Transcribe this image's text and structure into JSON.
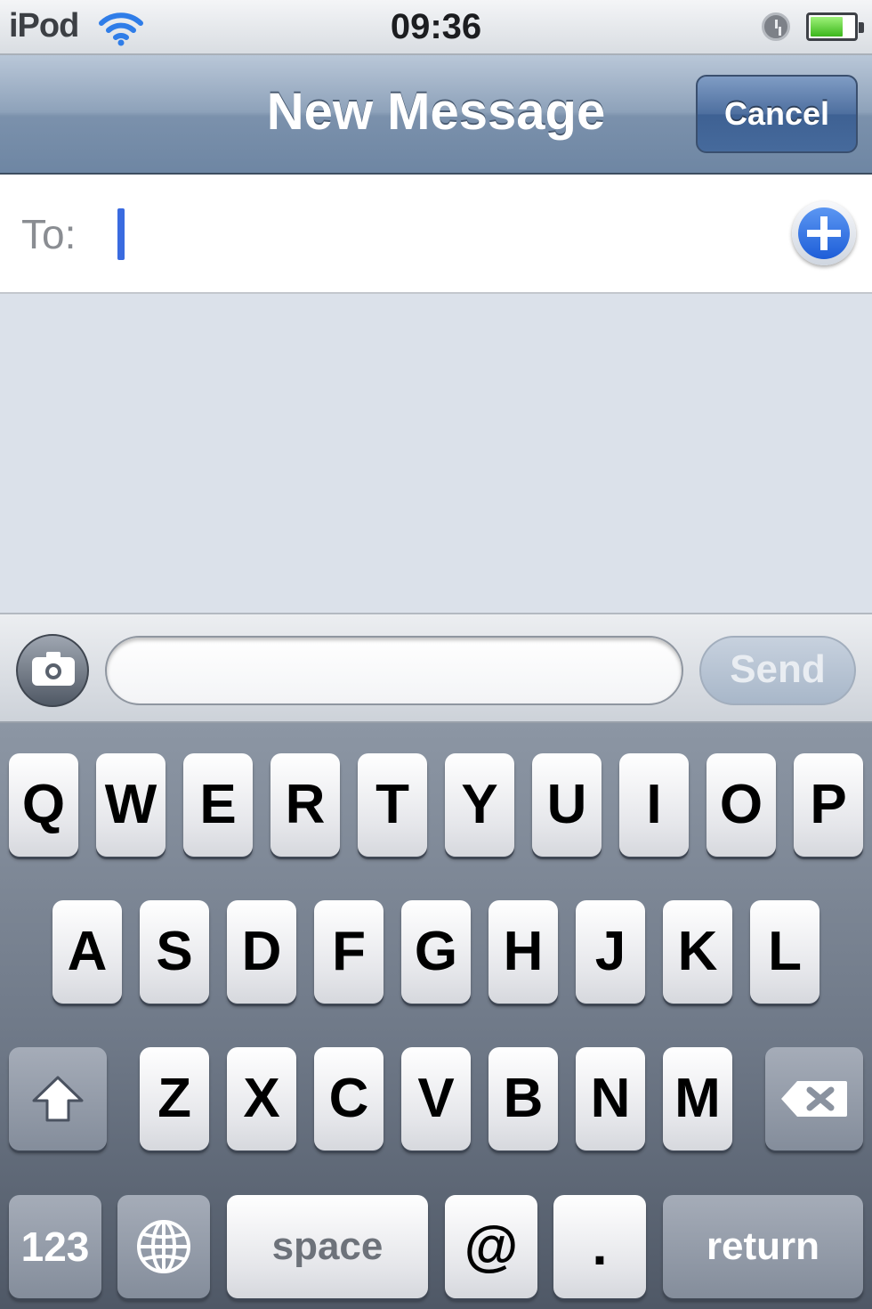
{
  "status_bar": {
    "carrier": "iPod",
    "time": "09:36",
    "battery_level": 0.7,
    "icons": [
      "wifi-icon",
      "clock-icon",
      "battery-icon"
    ]
  },
  "nav": {
    "title": "New Message",
    "cancel_label": "Cancel"
  },
  "to_field": {
    "label": "To:",
    "value": "",
    "add_icon": "plus-circle-icon"
  },
  "input_bar": {
    "camera_icon": "camera-icon",
    "message_value": "",
    "send_label": "Send"
  },
  "keyboard": {
    "row1": [
      "Q",
      "W",
      "E",
      "R",
      "T",
      "Y",
      "U",
      "I",
      "O",
      "P"
    ],
    "row2": [
      "A",
      "S",
      "D",
      "F",
      "G",
      "H",
      "J",
      "K",
      "L"
    ],
    "row3": [
      "Z",
      "X",
      "C",
      "V",
      "B",
      "N",
      "M"
    ],
    "shift_icon": "shift-arrow-icon",
    "delete_icon": "backspace-icon",
    "numbers_label": "123",
    "globe_icon": "globe-icon",
    "space_label": "space",
    "at_label": "@",
    "dot_label": ".",
    "return_label": "return"
  },
  "colors": {
    "nav_blue": "#7b91ac",
    "cancel_blue": "#466a9c",
    "cursor_blue": "#3a6be0",
    "add_blue": "#1e5ed8",
    "compose_bg": "#dbe1ea",
    "keyboard_bg": "#6e7887"
  }
}
